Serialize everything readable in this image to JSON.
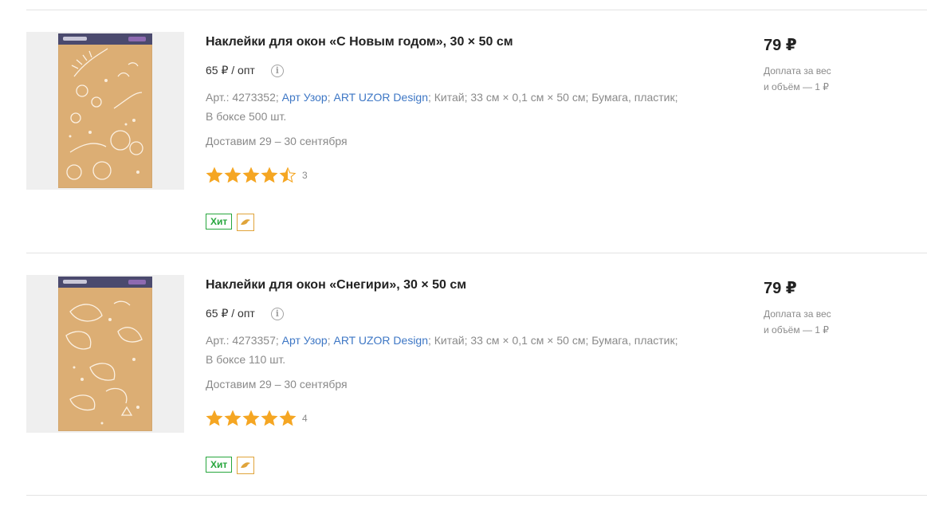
{
  "products": [
    {
      "title": "Наклейки для окон «С Новым годом», 30 × 50 см",
      "opt_price": "65 ₽ / опт",
      "info_icon": "info-icon",
      "article_prefix": "Арт.: 4273352;",
      "brand": "Арт Узор",
      "sep1": ";",
      "designer": "ART UZOR Design",
      "details": "; Китай; 33 см × 0,1 см × 50 см; Бумага, пластик;",
      "box": "В боксе 500 шт.",
      "delivery": "Доставим 29 – 30 сентября",
      "rating": 4.5,
      "rating_count": "3",
      "badge_hit": "Хит",
      "badge_icon": "dolphin-icon",
      "price": "79 ₽",
      "surcharge_line1": "Доплата за вес",
      "surcharge_line2": "и объём — 1 ₽",
      "image": "window-stickers-new-year-image"
    },
    {
      "title": "Наклейки для окон «Снегири», 30 × 50 см",
      "opt_price": "65 ₽ / опт",
      "info_icon": "info-icon",
      "article_prefix": "Арт.: 4273357;",
      "brand": "Арт Узор",
      "sep1": ";",
      "designer": "ART UZOR Design",
      "details": "; Китай; 33 см × 0,1 см × 50 см; Бумага, пластик;",
      "box": "В боксе 110 шт.",
      "delivery": "Доставим 29 – 30 сентября",
      "rating": 5,
      "rating_count": "4",
      "badge_hit": "Хит",
      "badge_icon": "dolphin-icon",
      "price": "79 ₽",
      "surcharge_line1": "Доплата за вес",
      "surcharge_line2": "и объём — 1 ₽",
      "image": "window-stickers-bullfinches-image"
    }
  ],
  "colors": {
    "star": "#f5a623",
    "link": "#3e77c5",
    "hit": "#27a63d",
    "badge_icon": "#e0a43a",
    "pack": "#dcae74"
  }
}
